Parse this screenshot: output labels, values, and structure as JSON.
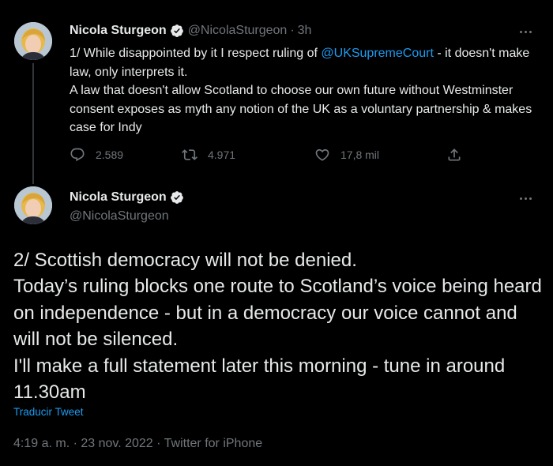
{
  "colors": {
    "background": "#000000",
    "text": "#e7e9ea",
    "muted": "#71767b",
    "accent": "#1d9bf0",
    "verified": "#e7e9ea"
  },
  "tweet1": {
    "name": "Nicola Sturgeon",
    "handle": "@NicolaSturgeon",
    "separator": "·",
    "time": "3h",
    "text_before_mention": "1/ While disappointed by it I respect ruling of ",
    "mention": "@UKSupremeCourt",
    "text_after_mention": " - it doesn't make law, only interprets it.",
    "line2": "A law that doesn't allow Scotland to choose our own future without Westminster consent exposes as myth any notion of the UK as a voluntary partnership & makes case for Indy",
    "reply_count": "2.589",
    "retweet_count": "4.971",
    "like_count": "17,8 mil",
    "icons": {
      "reply": "reply-icon",
      "retweet": "retweet-icon",
      "like": "like-icon",
      "share": "share-icon",
      "more": "more-icon"
    }
  },
  "tweet2": {
    "name": "Nicola Sturgeon",
    "handle": "@NicolaSturgeon",
    "lines": [
      "2/ Scottish democracy will not be denied.",
      "Today’s ruling blocks one route to Scotland’s voice being heard on independence - but in a democracy our voice cannot and will not be silenced.",
      "I'll make a full statement later this morning - tune in around 11.30am"
    ],
    "translate_label": "Traducir Tweet",
    "timestamp": "4:19 a. m. · 23 nov. 2022 · Twitter for iPhone"
  }
}
